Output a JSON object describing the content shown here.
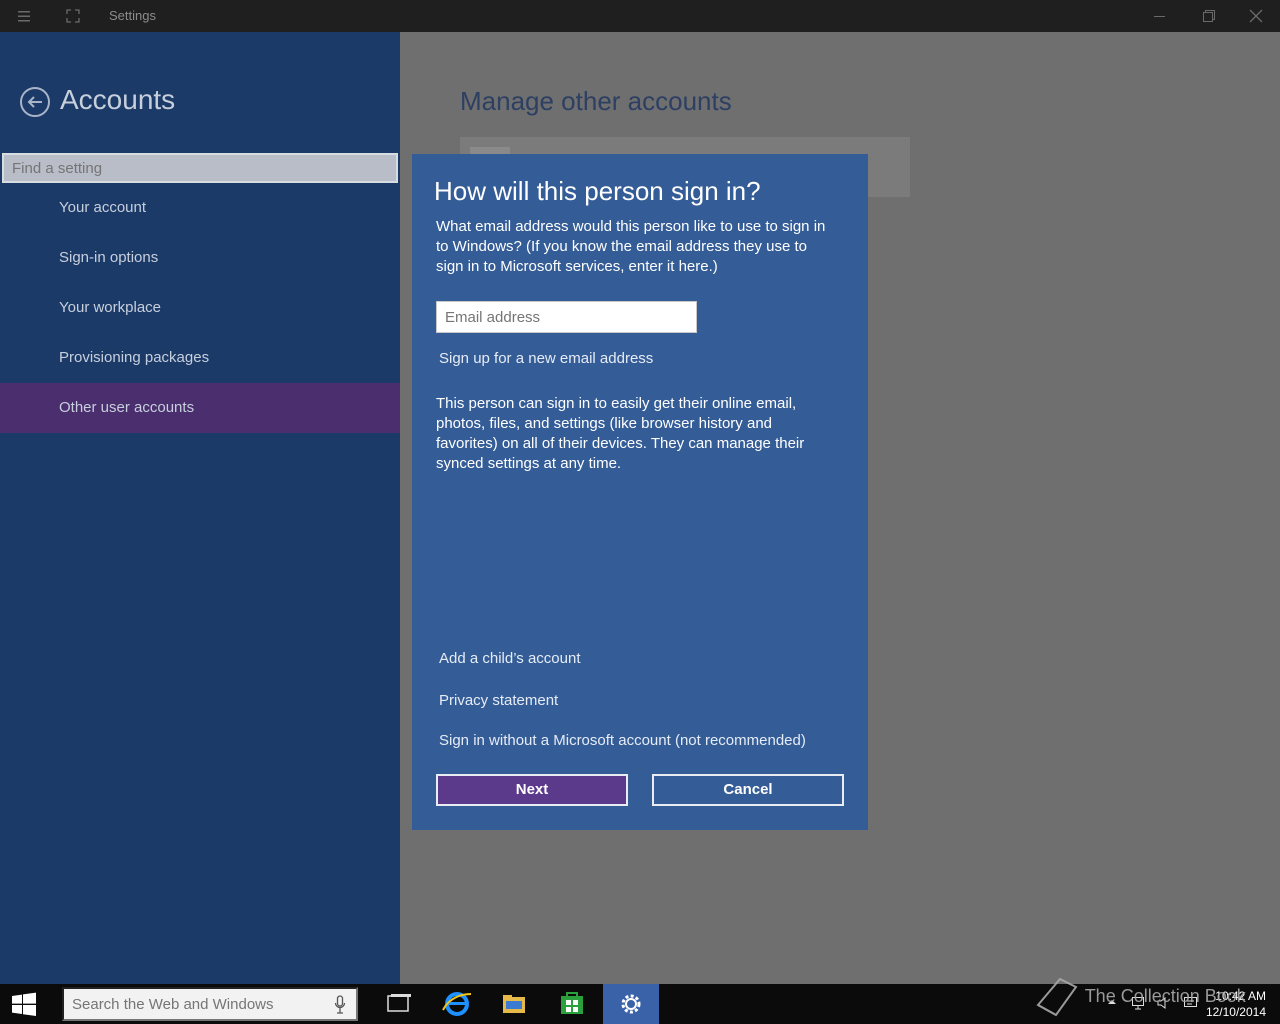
{
  "titlebar": {
    "title": "Settings"
  },
  "sidebar": {
    "section_title": "Accounts",
    "search_placeholder": "Find a setting",
    "items": [
      {
        "label": "Your account"
      },
      {
        "label": "Sign-in options"
      },
      {
        "label": "Your workplace"
      },
      {
        "label": "Provisioning packages"
      },
      {
        "label": "Other user accounts",
        "selected": true
      }
    ]
  },
  "main": {
    "title": "Manage other accounts"
  },
  "dialog": {
    "title": "How will this person sign in?",
    "description": "What email address would this person like to use to sign in to Windows? (If you know the email address they use to sign in to Microsoft services, enter it here.)",
    "email_placeholder": "Email address",
    "signup_link": "Sign up for a new email address",
    "info": "This person can sign in to easily get their online email, photos, files, and settings (like browser history and favorites) on all of their devices. They can manage their synced settings at any time.",
    "child_link": "Add a child’s account",
    "privacy_link": "Privacy statement",
    "no_ms_link": "Sign in without a Microsoft account (not recommended)",
    "next_label": "Next",
    "cancel_label": "Cancel"
  },
  "taskbar": {
    "search_placeholder": "Search the Web and Windows",
    "time": "10:42 AM",
    "date": "12/10/2014",
    "watermark": "The Collection Book"
  },
  "colors": {
    "sidebar_bg": "#1b3a67",
    "selected_item": "#4b2e6e",
    "dialog_bg": "#345c96",
    "next_button": "#5b3a8c"
  }
}
